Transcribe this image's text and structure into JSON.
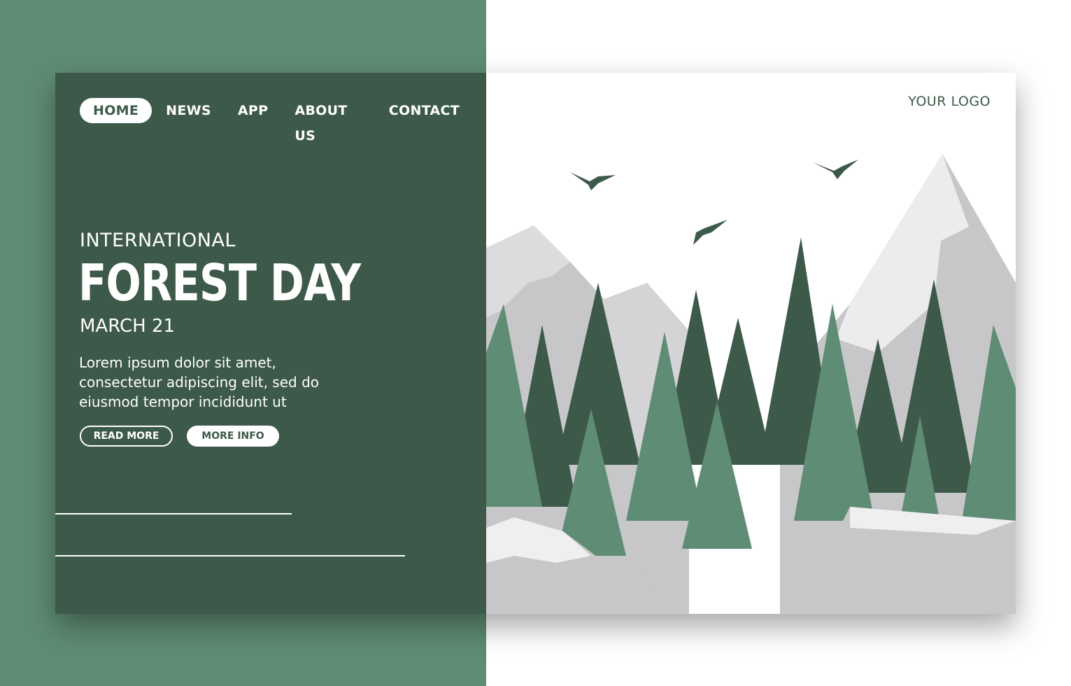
{
  "nav": {
    "items": [
      {
        "label": "HOME",
        "active": true
      },
      {
        "label": "NEWS"
      },
      {
        "label": "APP"
      },
      {
        "label": "ABOUT US"
      },
      {
        "label": "CONTACT"
      }
    ]
  },
  "logo": {
    "text": "YOUR LOGO"
  },
  "hero": {
    "kicker": "INTERNATIONAL",
    "title": "FOREST DAY",
    "date": "MARCH 21",
    "body": "Lorem ipsum dolor sit amet, consectetur adipiscing elit, sed do eiusmod tempor incididunt ut"
  },
  "buttons": {
    "read_more": "READ MORE",
    "more_info": "MORE INFO"
  },
  "colors": {
    "background_green": "#5f8c74",
    "panel_dark_green": "#3d5949",
    "tree_light": "#5f8c74",
    "tree_dark": "#3d5949",
    "rock_gray": "#c7c7c7"
  }
}
